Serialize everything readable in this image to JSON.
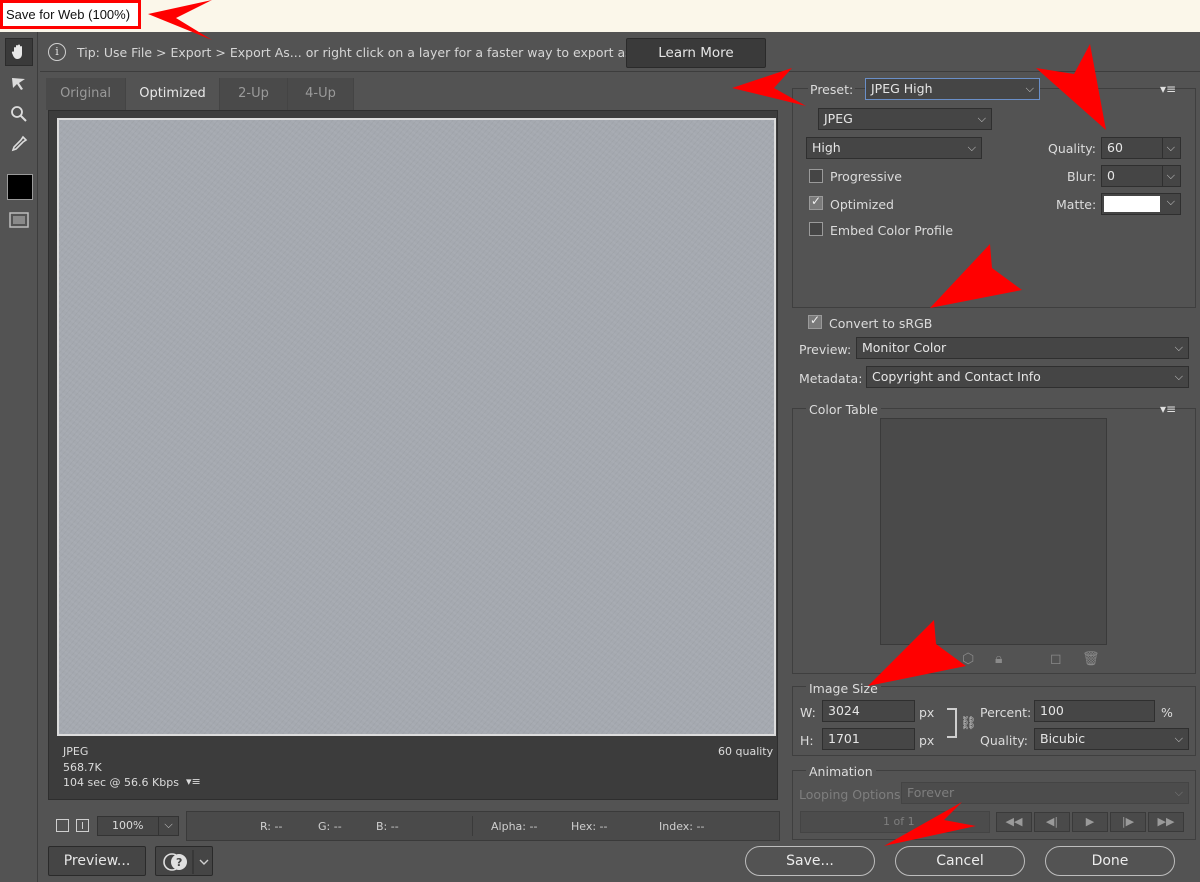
{
  "window": {
    "title": "Save for Web (100%)"
  },
  "tip": {
    "icon": "info-icon",
    "info_glyph": "i",
    "text": "Tip: Use File > Export > Export As...  or right click on a layer for a faster way to export assets",
    "learn_more": "Learn More"
  },
  "tabs": [
    {
      "label": "Original",
      "active": false
    },
    {
      "label": "Optimized",
      "active": true
    },
    {
      "label": "2-Up",
      "active": false
    },
    {
      "label": "4-Up",
      "active": false
    }
  ],
  "image_info": {
    "format": "JPEG",
    "size": "568.7K",
    "download": "104 sec @ 56.6 Kbps",
    "quality": "60 quality"
  },
  "status": {
    "zoom": "100%",
    "r": "R: --",
    "g": "G: --",
    "b": "B: --",
    "alpha": "Alpha: --",
    "hex": "Hex: --",
    "index": "Index: --"
  },
  "buttons": {
    "preview": "Preview...",
    "save": "Save...",
    "cancel": "Cancel",
    "done": "Done"
  },
  "settings": {
    "preset_label": "Preset:",
    "preset": "JPEG High",
    "format": "JPEG",
    "quality_level": "High",
    "quality_label": "Quality:",
    "quality": "60",
    "blur_label": "Blur:",
    "blur": "0",
    "matte_label": "Matte:",
    "matte_color": "#ffffff",
    "progressive": {
      "label": "Progressive",
      "checked": false
    },
    "optimized": {
      "label": "Optimized",
      "checked": true
    },
    "embed_profile": {
      "label": "Embed Color Profile",
      "checked": false
    },
    "convert_srgb": {
      "label": "Convert to sRGB",
      "checked": true
    },
    "preview_label": "Preview:",
    "preview": "Monitor Color",
    "metadata_label": "Metadata:",
    "metadata": "Copyright and Contact Info"
  },
  "color_table": {
    "title": "Color Table"
  },
  "image_size": {
    "title": "Image Size",
    "w_label": "W:",
    "width": "3024",
    "w_unit": "px",
    "h_label": "H:",
    "height": "1701",
    "h_unit": "px",
    "percent_label": "Percent:",
    "percent": "100",
    "percent_unit": "%",
    "quality_label": "Quality:",
    "quality": "Bicubic"
  },
  "animation": {
    "title": "Animation",
    "looping_label": "Looping Options:",
    "looping": "Forever",
    "frame": "1 of 1"
  },
  "colors": {
    "annotation_arrow": "#ff0000",
    "panel": "#535353",
    "image": "#a5a9b0"
  }
}
